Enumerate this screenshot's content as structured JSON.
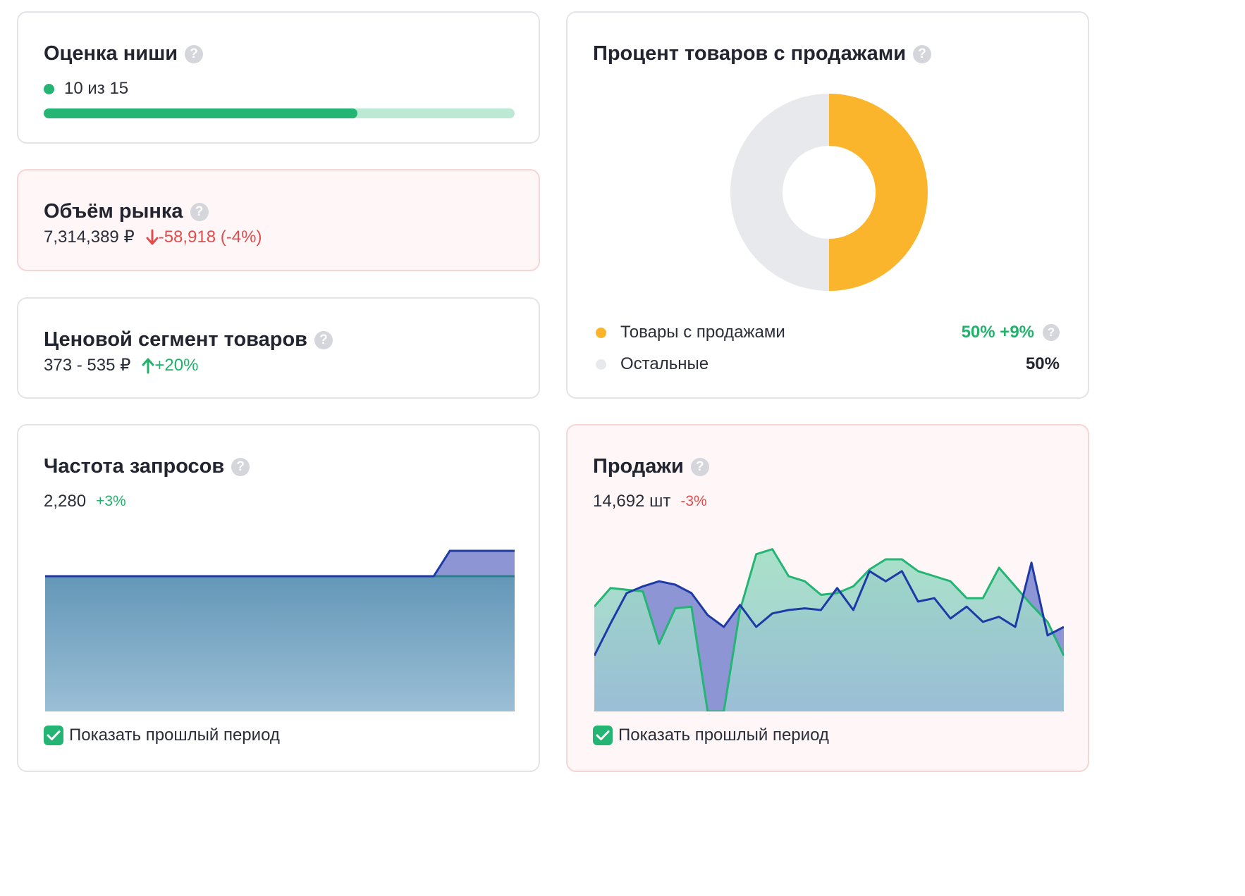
{
  "niche": {
    "title": "Оценка ниши",
    "score_text": "10 из 15",
    "score": 10,
    "max": 15,
    "color_fill": "#24b574",
    "color_track": "#bce9d3"
  },
  "market": {
    "title": "Объём рынка",
    "value": "7,314,389 ₽",
    "delta": "-58,918 (-4%)"
  },
  "price": {
    "title": "Ценовой сегмент товаров",
    "value": "373 - 535 ₽",
    "delta": "+20%"
  },
  "share": {
    "title": "Процент товаров с продажами",
    "legend": [
      {
        "label": "Товары с продажами",
        "value": "50%",
        "delta": "+9%",
        "color": "#fbb52c"
      },
      {
        "label": "Остальные",
        "value": "50%",
        "color": "#e8e9ec"
      }
    ],
    "chart_data": {
      "type": "pie",
      "labels": [
        "Товары с продажами",
        "Остальные"
      ],
      "values": [
        50,
        50
      ],
      "colors": [
        "#fbb52c",
        "#e8e9ec"
      ],
      "donut": true
    }
  },
  "queries": {
    "title": "Частота запросов",
    "value": "2,280",
    "delta": "+3%",
    "checkbox_label": "Показать прошлый период",
    "chart_data": {
      "type": "area",
      "grid": false,
      "ylim": [
        0,
        100
      ],
      "series": [
        {
          "values": [
            80,
            80,
            80,
            80,
            80,
            80,
            80,
            80,
            80,
            80,
            80,
            80,
            80,
            80,
            80,
            80,
            80,
            80,
            80,
            80,
            80,
            80,
            80,
            80,
            80,
            95,
            95,
            95,
            95,
            95
          ],
          "color": "#8e95d4",
          "stroke": "#1e3aa6"
        },
        {
          "values": [
            80,
            80,
            80,
            80,
            80,
            80,
            80,
            80,
            80,
            80,
            80,
            80,
            80,
            80,
            80,
            80,
            80,
            80,
            80,
            80,
            80,
            80,
            80,
            80,
            80,
            80,
            80,
            80,
            80,
            80
          ],
          "color": "#5f97b4",
          "stroke": "#2d7f8f",
          "gradient_bottom": "#9cc3d6"
        }
      ]
    }
  },
  "sales": {
    "title": "Продажи",
    "value": "14,692 шт",
    "delta": "-3%",
    "checkbox_label": "Показать прошлый период",
    "chart_data": {
      "type": "area",
      "grid": false,
      "ylim": [
        0,
        100
      ],
      "series": [
        {
          "values": [
            33,
            52,
            70,
            74,
            77,
            75,
            70,
            57,
            50,
            63,
            50,
            58,
            60,
            61,
            60,
            73,
            60,
            83,
            77,
            83,
            65,
            67,
            55,
            62,
            53,
            56,
            50,
            88,
            45,
            50
          ],
          "color": "#8e95d4",
          "stroke": "#1e3aa6"
        },
        {
          "values": [
            62,
            73,
            72,
            71,
            40,
            61,
            62,
            0,
            0,
            60,
            93,
            96,
            80,
            77,
            69,
            70,
            74,
            84,
            90,
            90,
            83,
            80,
            77,
            67,
            67,
            85,
            74,
            63,
            53,
            33
          ],
          "color": "#9fdfc3",
          "stroke": "#24b574",
          "gradient_bottom": "#9cc3d6"
        }
      ]
    }
  }
}
